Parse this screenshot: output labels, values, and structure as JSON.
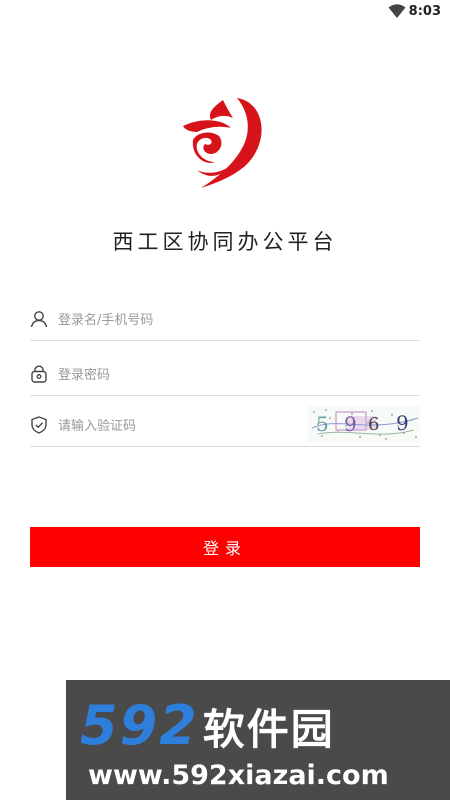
{
  "status_bar": {
    "time": "8:03",
    "wifi_icon": "wifi-icon"
  },
  "app": {
    "title": "西工区协同办公平台",
    "logo_icon": "app-logo-icon"
  },
  "form": {
    "username": {
      "placeholder": "登录名/手机号码",
      "value": "",
      "icon": "user-icon"
    },
    "password": {
      "placeholder": "登录密码",
      "value": "",
      "icon": "lock-icon"
    },
    "captcha": {
      "placeholder": "请输入验证码",
      "value": "",
      "icon": "shield-icon",
      "image_text": "5969"
    },
    "login_label": "登录"
  },
  "watermark": {
    "brand_num": "592",
    "brand_cn": "软件园",
    "url": "www.592xiazai.com"
  },
  "colors": {
    "primary": "#ff0000",
    "brand_blue": "#2e7fdc",
    "divider": "#dddddd",
    "placeholder": "#999999"
  }
}
